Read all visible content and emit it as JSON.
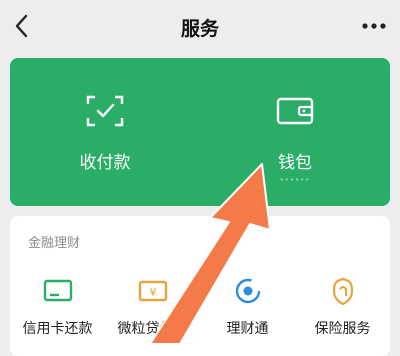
{
  "header": {
    "title": "服务",
    "back_icon": "chevron-left-icon",
    "more_icon": "more-dots-icon"
  },
  "payment_card": {
    "color": "#2aae67",
    "items": [
      {
        "label": "收付款",
        "icon": "scan-qr-icon"
      },
      {
        "label": "钱包",
        "icon": "wallet-icon",
        "sub": "••••••"
      }
    ]
  },
  "finance": {
    "section_title": "金融理财",
    "items": [
      {
        "label": "信用卡还款",
        "icon": "credit-card-icon",
        "color": "#2aae67"
      },
      {
        "label": "微粒贷借钱",
        "icon": "loan-icon",
        "color": "#e8a33d"
      },
      {
        "label": "理财通",
        "icon": "wealth-icon",
        "color": "#2a8de0"
      },
      {
        "label": "保险服务",
        "icon": "insurance-icon",
        "color": "#e8a33d"
      }
    ]
  },
  "annotation": {
    "icon": "pointer-arrow-icon",
    "color": "#f47a4a"
  }
}
